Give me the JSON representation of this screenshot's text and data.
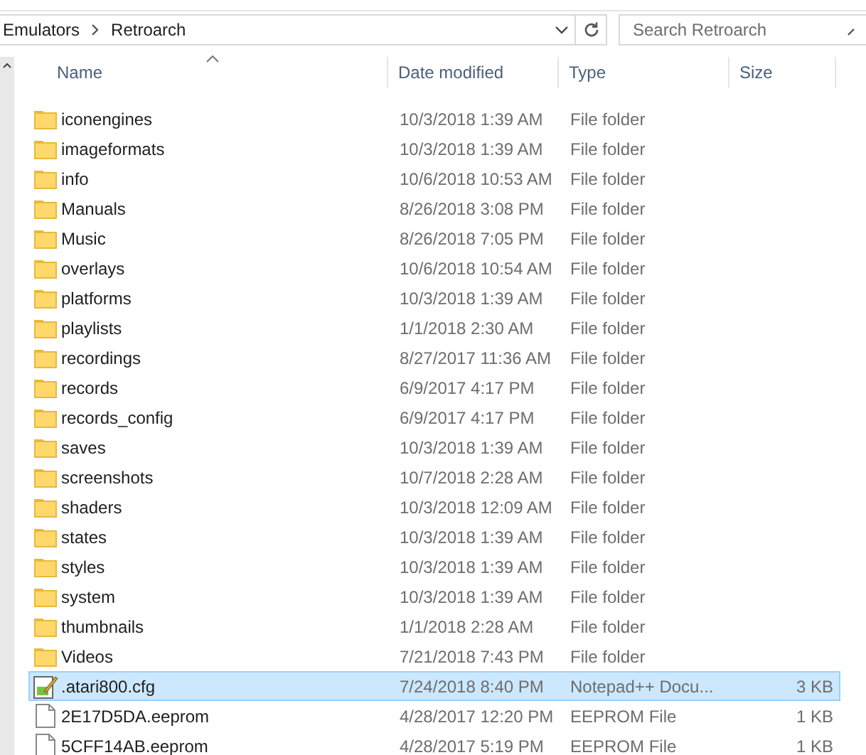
{
  "address_bar": {
    "breadcrumbs": [
      "Emulators",
      "Retroarch"
    ]
  },
  "search": {
    "placeholder": "Search Retroarch"
  },
  "columns": [
    {
      "label": "Name",
      "sorted": true
    },
    {
      "label": "Date modified",
      "sorted": false
    },
    {
      "label": "Type",
      "sorted": false
    },
    {
      "label": "Size",
      "sorted": false
    }
  ],
  "rows": [
    {
      "kind": "folder",
      "name": "iconengines",
      "date": "10/3/2018 1:39 AM",
      "type": "File folder",
      "selected": false
    },
    {
      "kind": "folder",
      "name": "imageformats",
      "date": "10/3/2018 1:39 AM",
      "type": "File folder",
      "selected": false
    },
    {
      "kind": "folder",
      "name": "info",
      "date": "10/6/2018 10:53 AM",
      "type": "File folder",
      "selected": false
    },
    {
      "kind": "folder",
      "name": "Manuals",
      "date": "8/26/2018 3:08 PM",
      "type": "File folder",
      "selected": false
    },
    {
      "kind": "folder",
      "name": "Music",
      "date": "8/26/2018 7:05 PM",
      "type": "File folder",
      "selected": false
    },
    {
      "kind": "folder",
      "name": "overlays",
      "date": "10/6/2018 10:54 AM",
      "type": "File folder",
      "selected": false
    },
    {
      "kind": "folder",
      "name": "platforms",
      "date": "10/3/2018 1:39 AM",
      "type": "File folder",
      "selected": false
    },
    {
      "kind": "folder",
      "name": "playlists",
      "date": "1/1/2018 2:30 AM",
      "type": "File folder",
      "selected": false
    },
    {
      "kind": "folder",
      "name": "recordings",
      "date": "8/27/2017 11:36 AM",
      "type": "File folder",
      "selected": false
    },
    {
      "kind": "folder",
      "name": "records",
      "date": "6/9/2017 4:17 PM",
      "type": "File folder",
      "selected": false
    },
    {
      "kind": "folder",
      "name": "records_config",
      "date": "6/9/2017 4:17 PM",
      "type": "File folder",
      "selected": false
    },
    {
      "kind": "folder",
      "name": "saves",
      "date": "10/3/2018 1:39 AM",
      "type": "File folder",
      "selected": false
    },
    {
      "kind": "folder",
      "name": "screenshots",
      "date": "10/7/2018 2:28 AM",
      "type": "File folder",
      "selected": false
    },
    {
      "kind": "folder",
      "name": "shaders",
      "date": "10/3/2018 12:09 AM",
      "type": "File folder",
      "selected": false
    },
    {
      "kind": "folder",
      "name": "states",
      "date": "10/3/2018 1:39 AM",
      "type": "File folder",
      "selected": false
    },
    {
      "kind": "folder",
      "name": "styles",
      "date": "10/3/2018 1:39 AM",
      "type": "File folder",
      "selected": false
    },
    {
      "kind": "folder",
      "name": "system",
      "date": "10/3/2018 1:39 AM",
      "type": "File folder",
      "selected": false
    },
    {
      "kind": "folder",
      "name": "thumbnails",
      "date": "1/1/2018 2:28 AM",
      "type": "File folder",
      "selected": false
    },
    {
      "kind": "folder",
      "name": "Videos",
      "date": "7/21/2018 7:43 PM",
      "type": "File folder",
      "selected": false
    },
    {
      "kind": "notepad",
      "name": ".atari800.cfg",
      "date": "7/24/2018 8:40 PM",
      "type": "Notepad++ Docu...",
      "size": "3 KB",
      "selected": true
    },
    {
      "kind": "file",
      "name": "2E17D5DA.eeprom",
      "date": "4/28/2017 12:20 PM",
      "type": "EEPROM File",
      "size": "1 KB",
      "selected": false
    },
    {
      "kind": "file",
      "name": "5CFF14AB.eeprom",
      "date": "4/28/2017 5:19 PM",
      "type": "EEPROM File",
      "size": "1 KB",
      "selected": false
    }
  ]
}
